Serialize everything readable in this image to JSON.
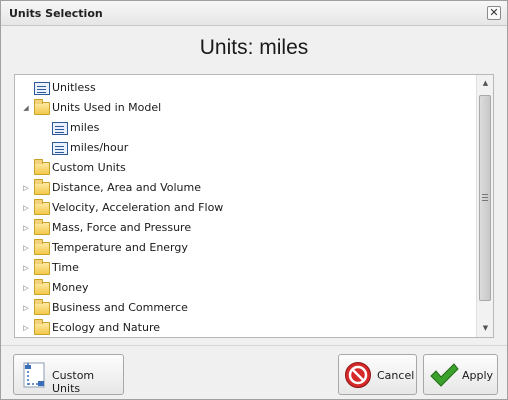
{
  "window": {
    "title": "Units Selection",
    "heading": "Units: miles"
  },
  "tree": {
    "items": [
      {
        "label": "Unitless",
        "type": "unit",
        "level": 0,
        "expander": "none"
      },
      {
        "label": "Units Used in Model",
        "type": "folder",
        "level": 0,
        "expander": "expanded"
      },
      {
        "label": "miles",
        "type": "unit",
        "level": 1,
        "expander": "none"
      },
      {
        "label": "miles/hour",
        "type": "unit",
        "level": 1,
        "expander": "none"
      },
      {
        "label": "Custom Units",
        "type": "folder",
        "level": 0,
        "expander": "none"
      },
      {
        "label": "Distance, Area and Volume",
        "type": "folder",
        "level": 0,
        "expander": "collapsed"
      },
      {
        "label": "Velocity, Acceleration and Flow",
        "type": "folder",
        "level": 0,
        "expander": "collapsed"
      },
      {
        "label": "Mass, Force and Pressure",
        "type": "folder",
        "level": 0,
        "expander": "collapsed"
      },
      {
        "label": "Temperature and Energy",
        "type": "folder",
        "level": 0,
        "expander": "collapsed"
      },
      {
        "label": "Time",
        "type": "folder",
        "level": 0,
        "expander": "collapsed"
      },
      {
        "label": "Money",
        "type": "folder",
        "level": 0,
        "expander": "collapsed"
      },
      {
        "label": "Business and Commerce",
        "type": "folder",
        "level": 0,
        "expander": "collapsed"
      },
      {
        "label": "Ecology and Nature",
        "type": "folder",
        "level": 0,
        "expander": "collapsed"
      }
    ]
  },
  "buttons": {
    "custom_units": "Custom Units",
    "cancel": "Cancel",
    "apply": "Apply"
  },
  "icons": {
    "close": "close-icon",
    "folder": "folder-icon",
    "unit": "unit-icon",
    "custom_units": "ruler-icon",
    "cancel": "no-entry-icon",
    "apply": "checkmark-icon"
  },
  "colors": {
    "folder": "#f2c94c",
    "unit_icon": "#2e5a9a",
    "cancel": "#d62a2a",
    "apply": "#3aa12a"
  }
}
